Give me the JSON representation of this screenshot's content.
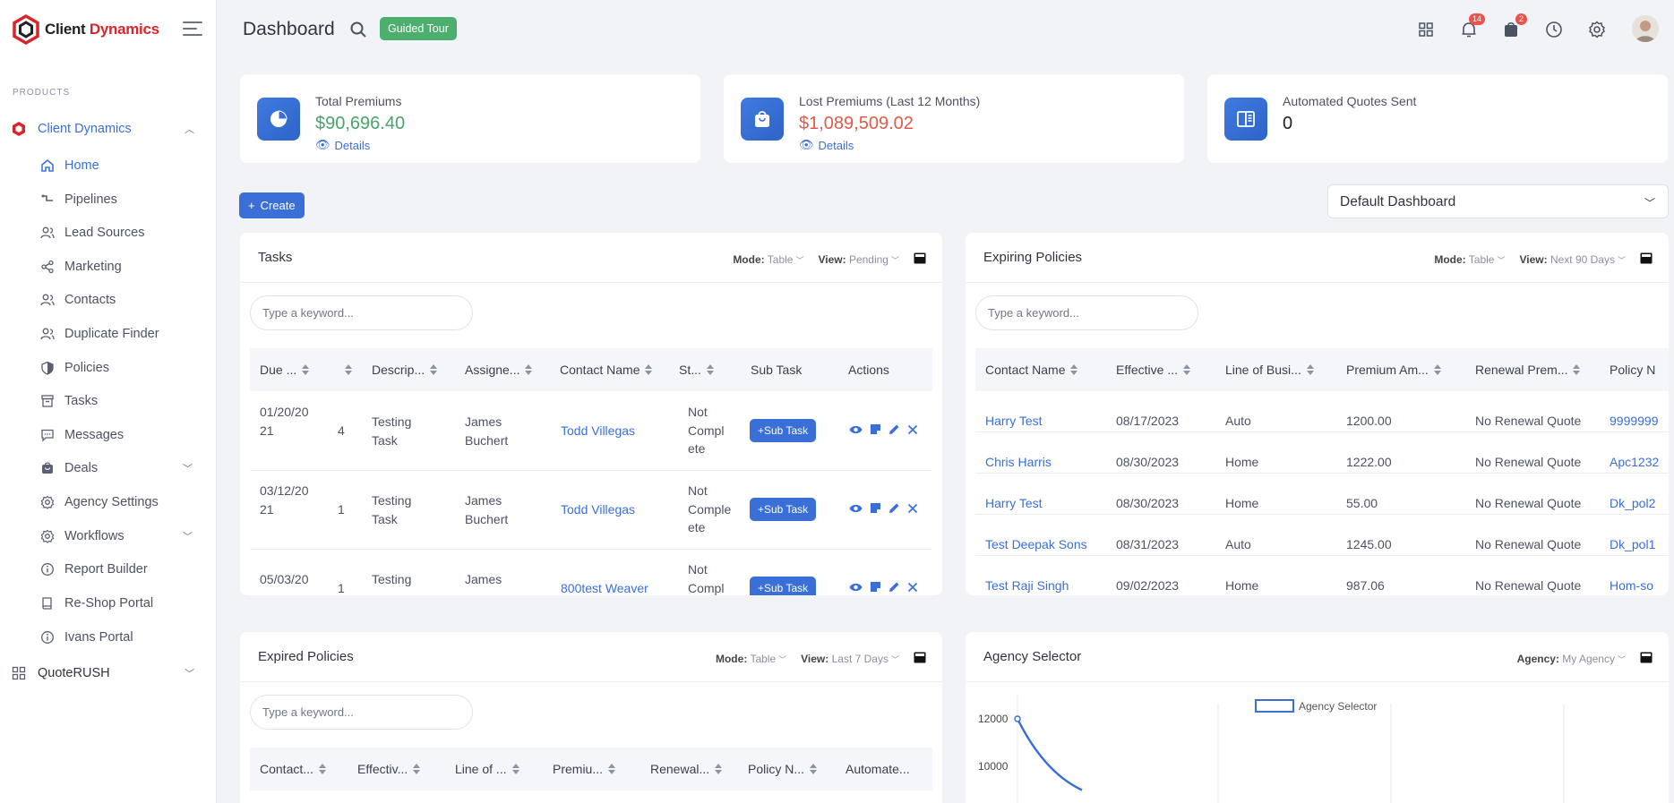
{
  "app": {
    "brand_main": "Client ",
    "brand_accent": "Dynamics"
  },
  "sidebar": {
    "section_label": "PRODUCTS",
    "group1": "Client Dynamics",
    "items": [
      "Home",
      "Pipelines",
      "Lead Sources",
      "Marketing",
      "Contacts",
      "Duplicate Finder",
      "Policies",
      "Tasks",
      "Messages",
      "Deals",
      "Agency Settings",
      "Workflows",
      "Report Builder",
      "Re-Shop Portal",
      "Ivans Portal"
    ],
    "group2": "QuoteRUSH"
  },
  "header": {
    "title": "Dashboard",
    "guided_tour": "Guided Tour",
    "notifications_count": "14",
    "tasks_count": "2"
  },
  "stats": [
    {
      "title": "Total Premiums",
      "value": "$90,696.40",
      "detail": "Details"
    },
    {
      "title": "Lost Premiums (Last 12 Months)",
      "value": "$1,089,509.02",
      "detail": "Details"
    },
    {
      "title": "Automated Quotes Sent",
      "value": "0"
    }
  ],
  "create_label": "Create",
  "dashboard_select": "Default Dashboard",
  "mode_label": "Mode:",
  "view_label": "View:",
  "agency_label": "Agency:",
  "keyword_placeholder": "Type a keyword...",
  "tasks": {
    "title": "Tasks",
    "mode": "Table",
    "view": "Pending",
    "columns": [
      "Due ...",
      "",
      "Descrip...",
      "Assigne...",
      "Contact Name",
      "St...",
      "Sub Task",
      "Actions"
    ],
    "subtask_label": "+Sub Task",
    "rows": [
      {
        "due": [
          "01/20/20",
          "21"
        ],
        "num": "4",
        "desc": [
          "Testing",
          "Task"
        ],
        "assignee": [
          "James",
          "Buchert"
        ],
        "contact": "Todd Villegas",
        "status": [
          "Not",
          "Complete",
          "ete"
        ]
      },
      {
        "due": [
          "03/12/20",
          "21"
        ],
        "num": "1",
        "desc": [
          "Testing",
          "Task"
        ],
        "assignee": [
          "James",
          "Buchert"
        ],
        "contact": "Todd Villegas",
        "status": [
          "Not",
          "Comple",
          "ete"
        ]
      },
      {
        "due": [
          "05/03/20",
          ""
        ],
        "num": "1",
        "desc": [
          "Testing",
          ""
        ],
        "assignee": [
          "James",
          ""
        ],
        "contact": "800test Weaver",
        "status": [
          "Not",
          "Compl",
          ""
        ]
      }
    ]
  },
  "expiring": {
    "title": "Expiring Policies",
    "mode": "Table",
    "view": "Next 90 Days",
    "columns": [
      "Contact Name",
      "Effective ...",
      "Line of Busi...",
      "Premium Am...",
      "Renewal Prem...",
      "Policy N"
    ],
    "rows": [
      {
        "contact": "Harry Test",
        "effective": "08/17/2023",
        "line": "Auto",
        "premium": "1200.00",
        "renewal": "No Renewal Quote",
        "policy": "9999999"
      },
      {
        "contact": "Chris Harris",
        "effective": "08/30/2023",
        "line": "Home",
        "premium": "1222.00",
        "renewal": "No Renewal Quote",
        "policy": "Apc1232"
      },
      {
        "contact": "Harry Test",
        "effective": "08/30/2023",
        "line": "Home",
        "premium": "55.00",
        "renewal": "No Renewal Quote",
        "policy": "Dk_pol2"
      },
      {
        "contact": "Test Deepak Sons",
        "effective": "08/31/2023",
        "line": "Auto",
        "premium": "1245.00",
        "renewal": "No Renewal Quote",
        "policy": "Dk_pol1"
      },
      {
        "contact": "Test Raji Singh",
        "effective": "09/02/2023",
        "line": "Home",
        "premium": "987.06",
        "renewal": "No Renewal Quote",
        "policy": "Hom-so"
      }
    ]
  },
  "expired": {
    "title": "Expired Policies",
    "mode": "Table",
    "view": "Last 7 Days",
    "columns": [
      "Contact...",
      "Effectiv...",
      "Line of ...",
      "Premiu...",
      "Renewal...",
      "Policy N...",
      "Automate..."
    ]
  },
  "agency": {
    "title": "Agency Selector",
    "agency": "My Agency"
  },
  "chart_data": {
    "type": "line",
    "series": [
      {
        "name": "Agency Selector",
        "values": [
          12000,
          9000
        ]
      }
    ],
    "y_ticks": [
      "12000",
      "10000"
    ],
    "ylim": [
      9000,
      12000
    ],
    "legend": "top",
    "color": "#3a6fd8"
  }
}
